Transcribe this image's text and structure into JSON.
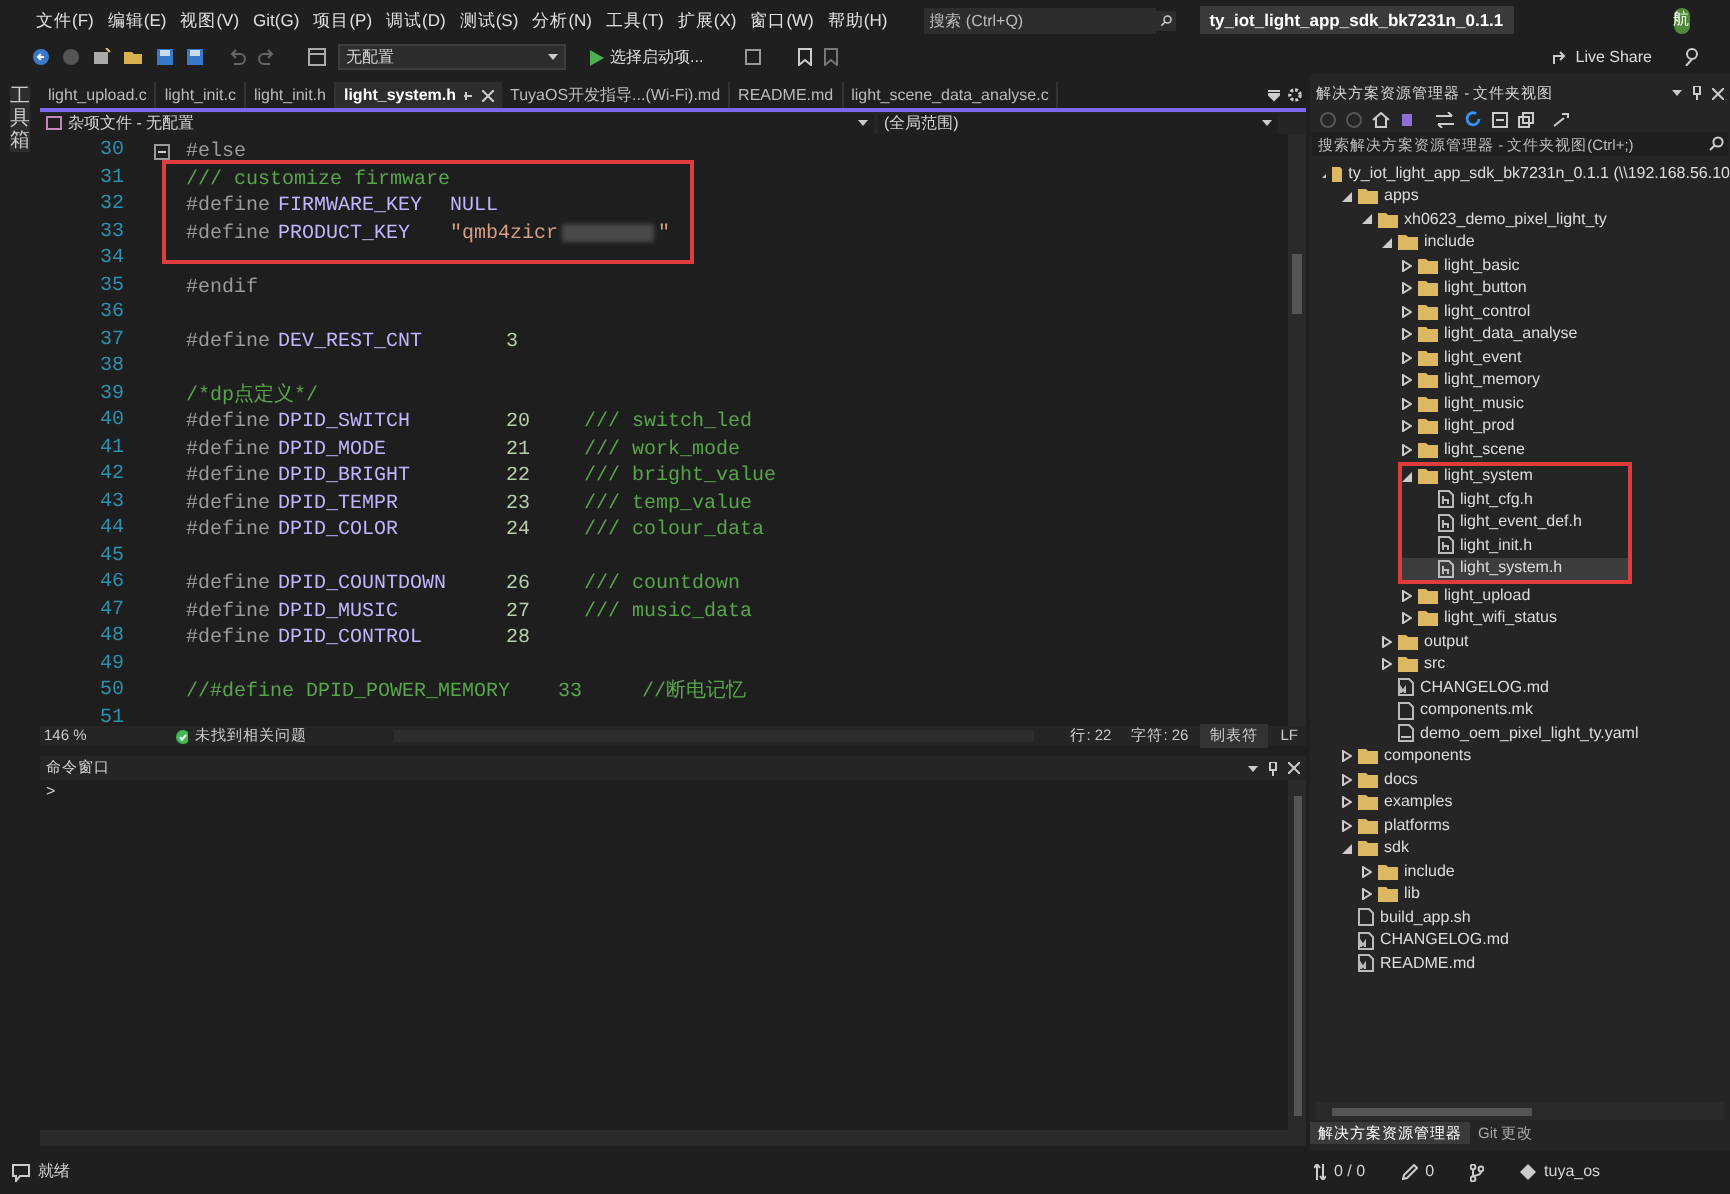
{
  "menu": {
    "items": [
      "文件(F)",
      "编辑(E)",
      "视图(V)",
      "Git(G)",
      "项目(P)",
      "调试(D)",
      "测试(S)",
      "分析(N)",
      "工具(T)",
      "扩展(X)",
      "窗口(W)",
      "帮助(H)"
    ],
    "search": {
      "placeholder": "搜索 (Ctrl+Q)"
    },
    "solution_title": "ty_iot_light_app_sdk_bk7231n_0.1.1",
    "avatar": "航"
  },
  "toolbar": {
    "config": "无配置",
    "start": "选择启动项...",
    "live_share": "Live Share"
  },
  "toolbox_label": "工具箱",
  "tabs": [
    {
      "label": "light_upload.c",
      "selected": false
    },
    {
      "label": "light_init.c",
      "selected": false
    },
    {
      "label": "light_init.h",
      "selected": false
    },
    {
      "label": "light_system.h",
      "selected": true
    },
    {
      "label": "TuyaOS开发指导...(Wi-Fi).md",
      "selected": false
    },
    {
      "label": "README.md",
      "selected": false
    },
    {
      "label": "light_scene_data_analyse.c",
      "selected": false
    }
  ],
  "nav": {
    "project": "杂项文件 - 无配置",
    "scope": "(全局范围)"
  },
  "code": {
    "lines": [
      {
        "n": "30",
        "kind": "keyword",
        "text": "#else",
        "fold": true
      },
      {
        "n": "31",
        "kind": "comment",
        "text": "/// customize firmware",
        "annotated": true
      },
      {
        "n": "32",
        "kind": "define",
        "directive": "#define",
        "name": "FIRMWARE_KEY",
        "value": {
          "text": "NULL",
          "kind": "macro"
        },
        "annotated": true
      },
      {
        "n": "33",
        "kind": "define",
        "directive": "#define",
        "name": "PRODUCT_KEY",
        "value": {
          "text": "\"qmb4zicr",
          "kind": "string"
        },
        "redacted": true,
        "value_tail": "\"",
        "annotated": true
      },
      {
        "n": "34",
        "kind": "blank"
      },
      {
        "n": "35",
        "kind": "keyword",
        "text": "#endif"
      },
      {
        "n": "36",
        "kind": "blank"
      },
      {
        "n": "37",
        "kind": "define",
        "directive": "#define",
        "name": "DEV_REST_CNT",
        "value": {
          "text": "3",
          "kind": "number"
        }
      },
      {
        "n": "38",
        "kind": "blank"
      },
      {
        "n": "39",
        "kind": "comment",
        "text": "/*dp点定义*/"
      },
      {
        "n": "40",
        "kind": "define",
        "directive": "#define",
        "name": "DPID_SWITCH",
        "value": {
          "text": "20",
          "kind": "number"
        },
        "comment": "/// switch_led"
      },
      {
        "n": "41",
        "kind": "define",
        "directive": "#define",
        "name": "DPID_MODE",
        "value": {
          "text": "21",
          "kind": "number"
        },
        "comment": "/// work_mode"
      },
      {
        "n": "42",
        "kind": "define",
        "directive": "#define",
        "name": "DPID_BRIGHT",
        "value": {
          "text": "22",
          "kind": "number"
        },
        "comment": "/// bright_value"
      },
      {
        "n": "43",
        "kind": "define",
        "directive": "#define",
        "name": "DPID_TEMPR",
        "value": {
          "text": "23",
          "kind": "number"
        },
        "comment": "/// temp_value"
      },
      {
        "n": "44",
        "kind": "define",
        "directive": "#define",
        "name": "DPID_COLOR",
        "value": {
          "text": "24",
          "kind": "number"
        },
        "comment": "/// colour_data"
      },
      {
        "n": "45",
        "kind": "blank"
      },
      {
        "n": "46",
        "kind": "define",
        "directive": "#define",
        "name": "DPID_COUNTDOWN",
        "value": {
          "text": "26",
          "kind": "number"
        },
        "comment": "/// countdown"
      },
      {
        "n": "47",
        "kind": "define",
        "directive": "#define",
        "name": "DPID_MUSIC",
        "value": {
          "text": "27",
          "kind": "number"
        },
        "comment": "/// music_data"
      },
      {
        "n": "48",
        "kind": "define",
        "directive": "#define",
        "name": "DPID_CONTROL",
        "value": {
          "text": "28",
          "kind": "number"
        }
      },
      {
        "n": "49",
        "kind": "blank"
      },
      {
        "n": "50",
        "kind": "comment",
        "text": "//#define DPID_POWER_MEMORY    33     //断电记忆"
      },
      {
        "n": "51",
        "kind": "blank"
      }
    ]
  },
  "editor_status": {
    "zoom": "146 %",
    "issues": "未找到相关问题",
    "line": "行: 22",
    "char": "字符: 26",
    "indent": "制表符",
    "eol": "LF"
  },
  "command_window": {
    "title": "命令窗口",
    "prompt": ">"
  },
  "solution_explorer": {
    "title": "解决方案资源管理器 - 文件夹视图",
    "search": {
      "placeholder": "搜索解决方案资源管理器 - 文件夹视图(Ctrl+;)"
    },
    "tree": [
      {
        "label": "ty_iot_light_app_sdk_bk7231n_0.1.1 (\\\\192.168.56.10",
        "kind": "folder",
        "expanded": true,
        "selected": false,
        "children": [
          {
            "label": "apps",
            "kind": "folder",
            "expanded": true,
            "selected": false,
            "children": [
              {
                "label": "xh0623_demo_pixel_light_ty",
                "kind": "folder",
                "expanded": true,
                "selected": false,
                "children": [
                  {
                    "label": "include",
                    "kind": "folder",
                    "expanded": true,
                    "selected": false,
                    "children": [
                      {
                        "label": "light_basic",
                        "kind": "folder",
                        "expanded": false,
                        "selected": false
                      },
                      {
                        "label": "light_button",
                        "kind": "folder",
                        "expanded": false,
                        "selected": false
                      },
                      {
                        "label": "light_control",
                        "kind": "folder",
                        "expanded": false,
                        "selected": false
                      },
                      {
                        "label": "light_data_analyse",
                        "kind": "folder",
                        "expanded": false,
                        "selected": false
                      },
                      {
                        "label": "light_event",
                        "kind": "folder",
                        "expanded": false,
                        "selected": false
                      },
                      {
                        "label": "light_memory",
                        "kind": "folder",
                        "expanded": false,
                        "selected": false
                      },
                      {
                        "label": "light_music",
                        "kind": "folder",
                        "expanded": false,
                        "selected": false
                      },
                      {
                        "label": "light_prod",
                        "kind": "folder",
                        "expanded": false,
                        "selected": false
                      },
                      {
                        "label": "light_scene",
                        "kind": "folder",
                        "expanded": false,
                        "selected": false
                      },
                      {
                        "label": "light_system",
                        "kind": "folder",
                        "expanded": true,
                        "selected": false,
                        "annotated": true,
                        "children": [
                          {
                            "label": "light_cfg.h",
                            "kind": "header",
                            "selected": false
                          },
                          {
                            "label": "light_event_def.h",
                            "kind": "header",
                            "selected": false
                          },
                          {
                            "label": "light_init.h",
                            "kind": "header",
                            "selected": false
                          },
                          {
                            "label": "light_system.h",
                            "kind": "header",
                            "selected": true
                          }
                        ]
                      },
                      {
                        "label": "light_upload",
                        "kind": "folder",
                        "expanded": false,
                        "selected": false
                      },
                      {
                        "label": "light_wifi_status",
                        "kind": "folder",
                        "expanded": false,
                        "selected": false
                      }
                    ]
                  },
                  {
                    "label": "output",
                    "kind": "folder",
                    "expanded": false,
                    "selected": false
                  },
                  {
                    "label": "src",
                    "kind": "folder",
                    "expanded": false,
                    "selected": false
                  },
                  {
                    "label": "CHANGELOG.md",
                    "kind": "markdown",
                    "selected": false
                  },
                  {
                    "label": "components.mk",
                    "kind": "file",
                    "selected": false
                  },
                  {
                    "label": "demo_oem_pixel_light_ty.yaml",
                    "kind": "yaml",
                    "selected": false
                  }
                ]
              }
            ]
          },
          {
            "label": "components",
            "kind": "folder",
            "expanded": false,
            "selected": false
          },
          {
            "label": "docs",
            "kind": "folder",
            "expanded": false,
            "selected": false
          },
          {
            "label": "examples",
            "kind": "folder",
            "expanded": false,
            "selected": false
          },
          {
            "label": "platforms",
            "kind": "folder",
            "expanded": false,
            "selected": false
          },
          {
            "label": "sdk",
            "kind": "folder",
            "expanded": true,
            "selected": false,
            "children": [
              {
                "label": "include",
                "kind": "folder",
                "expanded": false,
                "selected": false
              },
              {
                "label": "lib",
                "kind": "folder",
                "expanded": false,
                "selected": false
              }
            ]
          },
          {
            "label": "build_app.sh",
            "kind": "file",
            "selected": false
          },
          {
            "label": "CHANGELOG.md",
            "kind": "markdown",
            "selected": false
          },
          {
            "label": "README.md",
            "kind": "markdown",
            "selected": false
          }
        ]
      }
    ],
    "tabs": [
      {
        "label": "解决方案资源管理器",
        "selected": true
      },
      {
        "label": "Git 更改",
        "selected": false
      }
    ]
  },
  "status_bar": {
    "text": "就绪",
    "sync": "0 / 0",
    "edits": "0",
    "branch": "tuya_os"
  }
}
